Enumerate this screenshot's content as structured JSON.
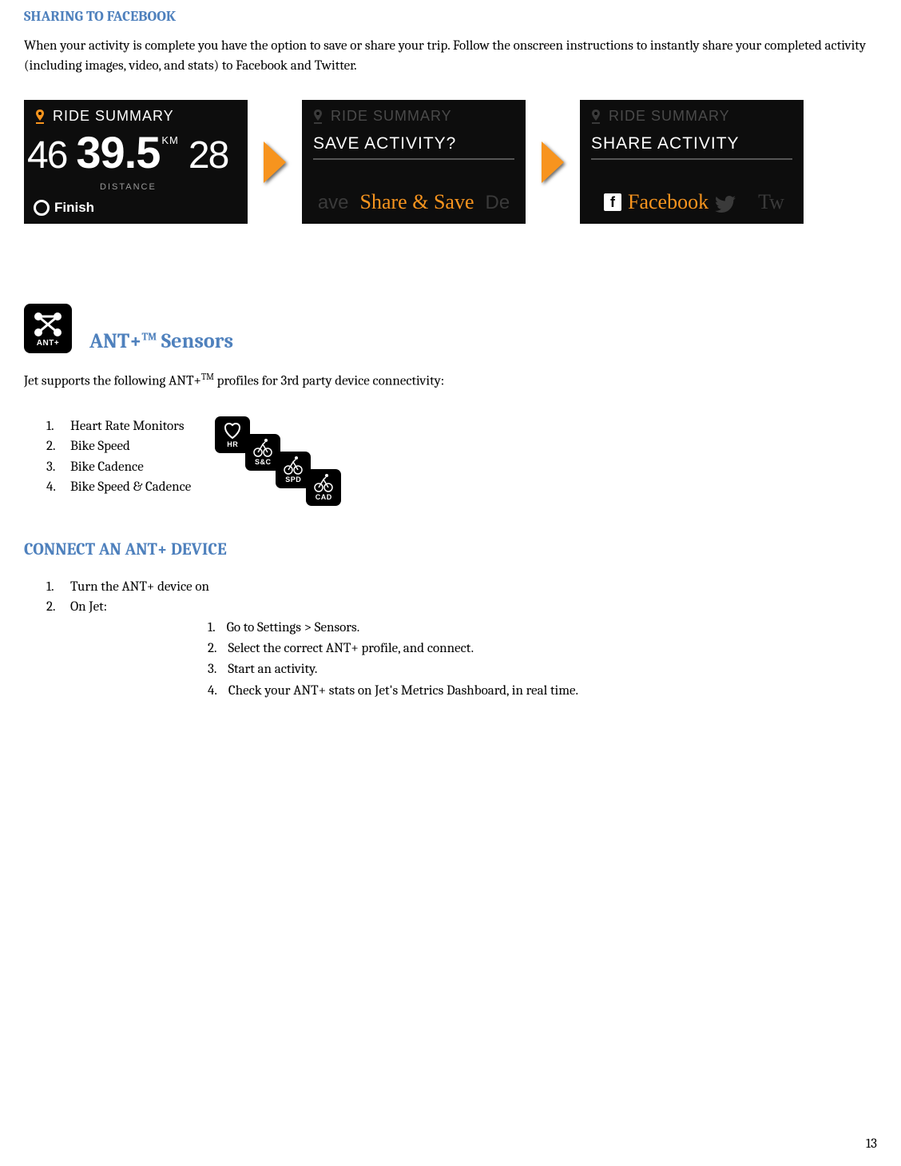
{
  "section_sharing": {
    "title": "SHARING TO FACEBOOK",
    "body": "When your activity is complete you have the option to save or share your trip. Follow the onscreen instructions to instantly share your completed activity (including images, video, and stats) to Facebook and Twitter."
  },
  "screens": {
    "s1": {
      "title": "RIDE SUMMARY",
      "n_left": "46",
      "n_mid": "39.5",
      "km": "KM",
      "dist": "DISTANCE",
      "n_right": "28",
      "finish": "Finish"
    },
    "s2": {
      "title": "RIDE SUMMARY",
      "overlay": "SAVE ACTIVITY?",
      "left": "ave",
      "mid": "Share & Save",
      "right": "De"
    },
    "s3": {
      "title": "RIDE SUMMARY",
      "overlay": "SHARE ACTIVITY",
      "fb": "Facebook",
      "tw": "Tw"
    }
  },
  "ant_section": {
    "icon_label": "ANT+",
    "title_prefix": "ANT+",
    "title_suffix": " Sensors",
    "tm": "TM",
    "body_prefix": "Jet supports the following ANT+",
    "body_suffix": " profiles for 3rd party device connectivity:",
    "list": [
      "Heart Rate Monitors",
      "Bike Speed",
      "Bike Cadence",
      "Bike Speed & Cadence"
    ],
    "sensor_labels": {
      "hr": "HR",
      "sc": "S&C",
      "spd": "SPD",
      "cad": "CAD"
    }
  },
  "connect_section": {
    "title": "CONNECT AN ANT+ DEVICE",
    "outer": [
      "Turn the ANT+ device on",
      "On Jet:"
    ],
    "inner": [
      "Go to Settings > Sensors.",
      "Select the correct ANT+ profile, and connect.",
      "Start an activity.",
      "Check your ANT+ stats on Jet's Metrics Dashboard, in real time."
    ]
  },
  "page_number": "13"
}
